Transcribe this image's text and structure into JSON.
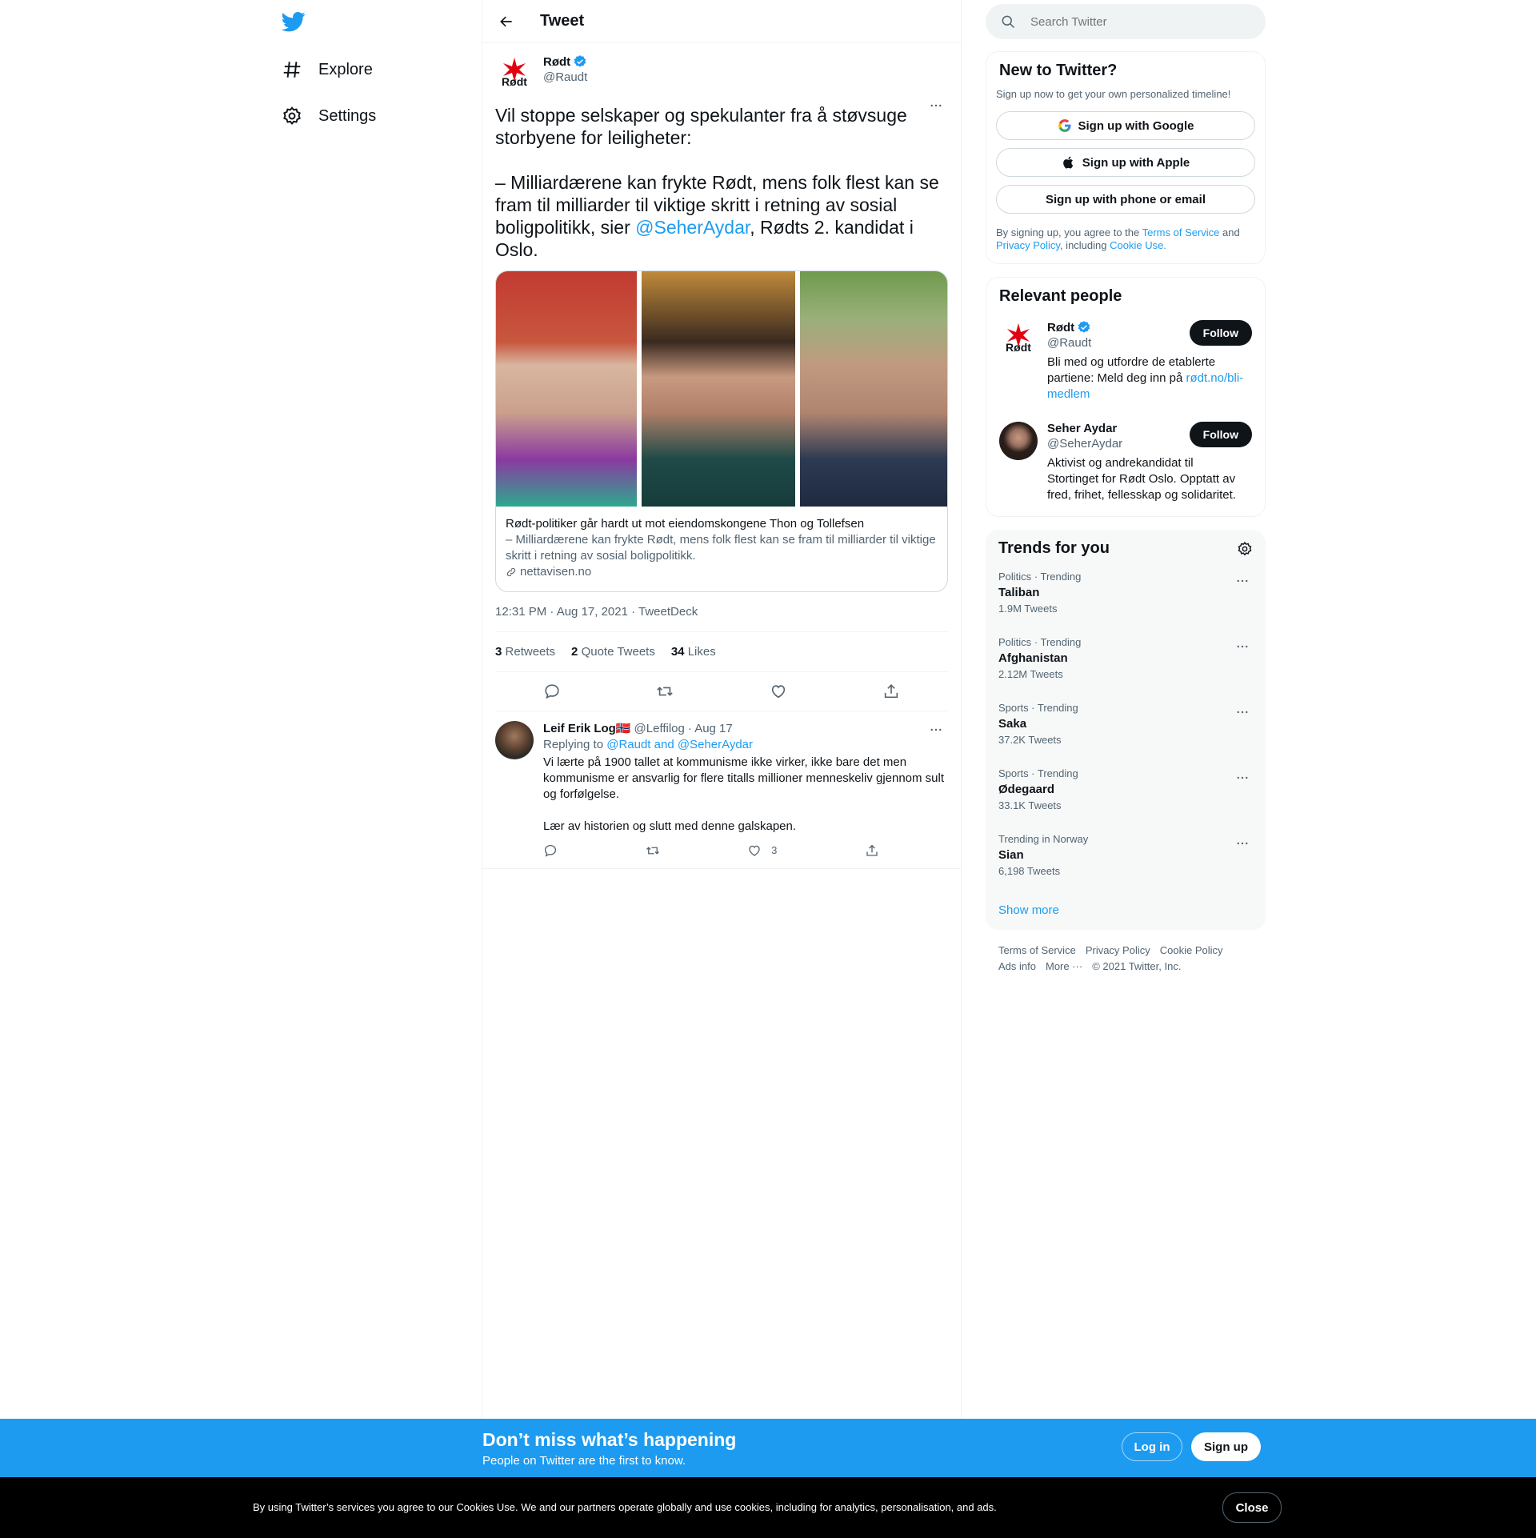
{
  "nav": {
    "logo_icon": "twitter-bird-icon",
    "items": [
      {
        "label": "Explore",
        "icon": "hashtag-icon"
      },
      {
        "label": "Settings",
        "icon": "gear-icon"
      }
    ]
  },
  "main": {
    "header_title": "Tweet",
    "tweet": {
      "author_name": "Rødt",
      "author_handle": "@Raudt",
      "avatar_text": "Rødt",
      "text_part1": "Vil stoppe selskaper og spekulanter fra å støvsuge storbyene for leiligheter:\n\n– Milliardærene kan frykte Rødt, mens folk flest kan se fram til milliarder til viktige skritt i retning av sosial boligpolitikk, sier ",
      "mention": "@SeherAydar",
      "text_part2": ", Rødts 2. kandidat i Oslo.",
      "card": {
        "title": "Rødt-politiker går hardt ut mot eiendomskongene Thon og Tollefsen",
        "description": "– Milliardærene kan frykte Rødt, mens folk flest kan se fram til milliarder til viktige skritt i retning av sosial boligpolitikk.",
        "domain": "nettavisen.no"
      },
      "timestamp": "12:31 PM · Aug 17, 2021 · TweetDeck",
      "stats": {
        "retweets_count": "3",
        "retweets_label": "Retweets",
        "quotes_count": "2",
        "quotes_label": "Quote Tweets",
        "likes_count": "34",
        "likes_label": "Likes"
      }
    },
    "reply": {
      "name": "Leif Erik Log",
      "flag": "🇳🇴",
      "handle": "@Leffilog",
      "date": "· Aug 17",
      "replying_prefix": "Replying to",
      "replying_to": "@Raudt and @SeherAydar",
      "text": "Vi lærte på 1900 tallet at kommunisme ikke virker, ikke bare det men kommunisme er ansvarlig for flere titalls millioner menneskeliv gjennom sult og forfølgelse.\n\nLær av historien og slutt med denne galskapen.",
      "like_count": "3"
    }
  },
  "right": {
    "search_placeholder": "Search Twitter",
    "signup": {
      "title": "New to Twitter?",
      "subtitle": "Sign up now to get your own personalized timeline!",
      "google": "Sign up with Google",
      "apple": "Sign up with Apple",
      "phone": "Sign up with phone or email",
      "legal_1": "By signing up, you agree to the ",
      "tos": "Terms of Service",
      "legal_2": " and ",
      "privacy": "Privacy Policy",
      "legal_3": ", including ",
      "cookie": "Cookie Use."
    },
    "relevant": {
      "title": "Relevant people",
      "people": [
        {
          "name": "Rødt",
          "handle": "@Raudt",
          "follow": "Follow",
          "bio": "Bli med og utfordre de etablerte partiene: Meld deg inn på ",
          "bio_link": "rødt.no/bli-medlem"
        },
        {
          "name": "Seher Aydar",
          "handle": "@SeherAydar",
          "follow": "Follow",
          "bio": "Aktivist og andrekandidat til Stortinget for Rødt Oslo. Opptatt av fred, frihet, fellesskap og solidaritet."
        }
      ]
    },
    "trends": {
      "title": "Trends for you",
      "items": [
        {
          "meta": "Politics · Trending",
          "name": "Taliban",
          "count": "1.9M Tweets"
        },
        {
          "meta": "Politics · Trending",
          "name": "Afghanistan",
          "count": "2.12M Tweets"
        },
        {
          "meta": "Sports · Trending",
          "name": "Saka",
          "count": "37.2K Tweets"
        },
        {
          "meta": "Sports · Trending",
          "name": "Ødegaard",
          "count": "33.1K Tweets"
        },
        {
          "meta": "Trending in Norway",
          "name": "Sian",
          "count": "6,198 Tweets"
        }
      ],
      "show_more": "Show more"
    },
    "footer": {
      "tos": "Terms of Service",
      "privacy": "Privacy Policy",
      "cookie": "Cookie Policy",
      "ads": "Ads info",
      "more": "More ···",
      "copyright": "© 2021 Twitter, Inc."
    }
  },
  "banner": {
    "title": "Don’t miss what’s happening",
    "subtitle": "People on Twitter are the first to know.",
    "login": "Log in",
    "signup": "Sign up"
  },
  "cookie": {
    "text": "By using Twitter’s services you agree to our Cookies Use. We and our partners operate globally and use cookies, including for analytics, personalisation, and ads.",
    "close": "Close"
  },
  "colors": {
    "accent": "#1d9bf0",
    "text": "#0f1419",
    "secondary": "#536471",
    "rodt_red": "#e3000f"
  }
}
